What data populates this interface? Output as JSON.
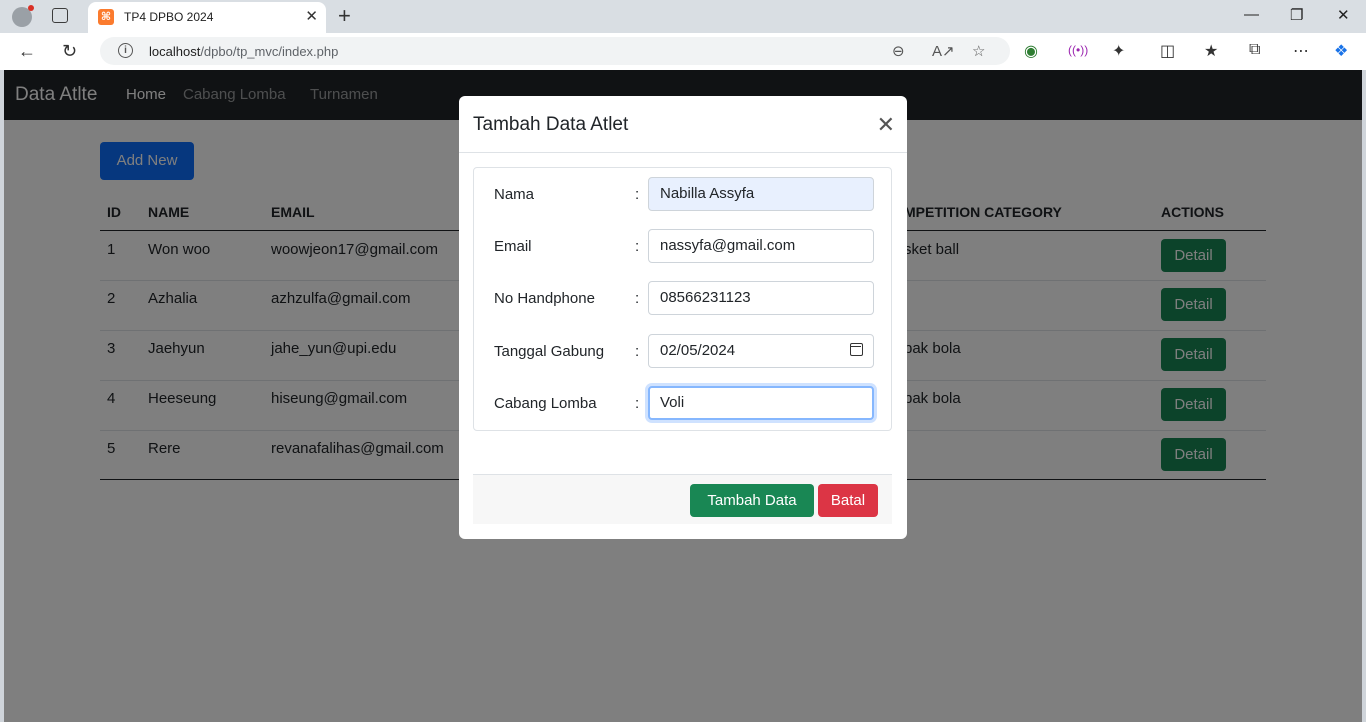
{
  "browser": {
    "tab_title": "TP4 DPBO 2024",
    "tab_favicon": "xampp-icon",
    "url_host": "localhost",
    "url_path": "/dpbo/tp_mvc/index.php"
  },
  "navbar": {
    "brand": "Data Atlte",
    "links": [
      "Home",
      "Cabang Lomba",
      "Turnamen"
    ]
  },
  "main": {
    "add_button": "Add New",
    "headers": {
      "id": "ID",
      "name": "NAME",
      "email": "EMAIL",
      "category": "MPETITION CATEGORY",
      "actions": "ACTIONS"
    },
    "rows": [
      {
        "id": "1",
        "name": "Won woo",
        "email": "woowjeon17@gmail.com",
        "category": "sket ball",
        "action": "Detail"
      },
      {
        "id": "2",
        "name": "Azhalia",
        "email": "azhzulfa@gmail.com",
        "category": "i",
        "action": "Detail"
      },
      {
        "id": "3",
        "name": "Jaehyun",
        "email": "jahe_yun@upi.edu",
        "category": "bak bola",
        "action": "Detail"
      },
      {
        "id": "4",
        "name": "Heeseung",
        "email": "hiseung@gmail.com",
        "category": "bak bola",
        "action": "Detail"
      },
      {
        "id": "5",
        "name": "Rere",
        "email": "revanafalihas@gmail.com",
        "category": "i",
        "action": "Detail"
      }
    ]
  },
  "modal": {
    "title": "Tambah Data Atlet",
    "colon": ":",
    "fields": [
      {
        "label": "Nama",
        "value": "Nabilla Assyfa"
      },
      {
        "label": "Email",
        "value": "nassyfa@gmail.com"
      },
      {
        "label": "No Handphone",
        "value": "08566231123"
      },
      {
        "label": "Tanggal Gabung",
        "value": "02/05/2024"
      },
      {
        "label": "Cabang Lomba",
        "value": "Voli"
      }
    ],
    "submit_label": "Tambah Data",
    "cancel_label": "Batal"
  },
  "colors": {
    "primary": "#0d6efd",
    "success": "#198754",
    "danger": "#dc3545",
    "navbar": "#212529"
  }
}
